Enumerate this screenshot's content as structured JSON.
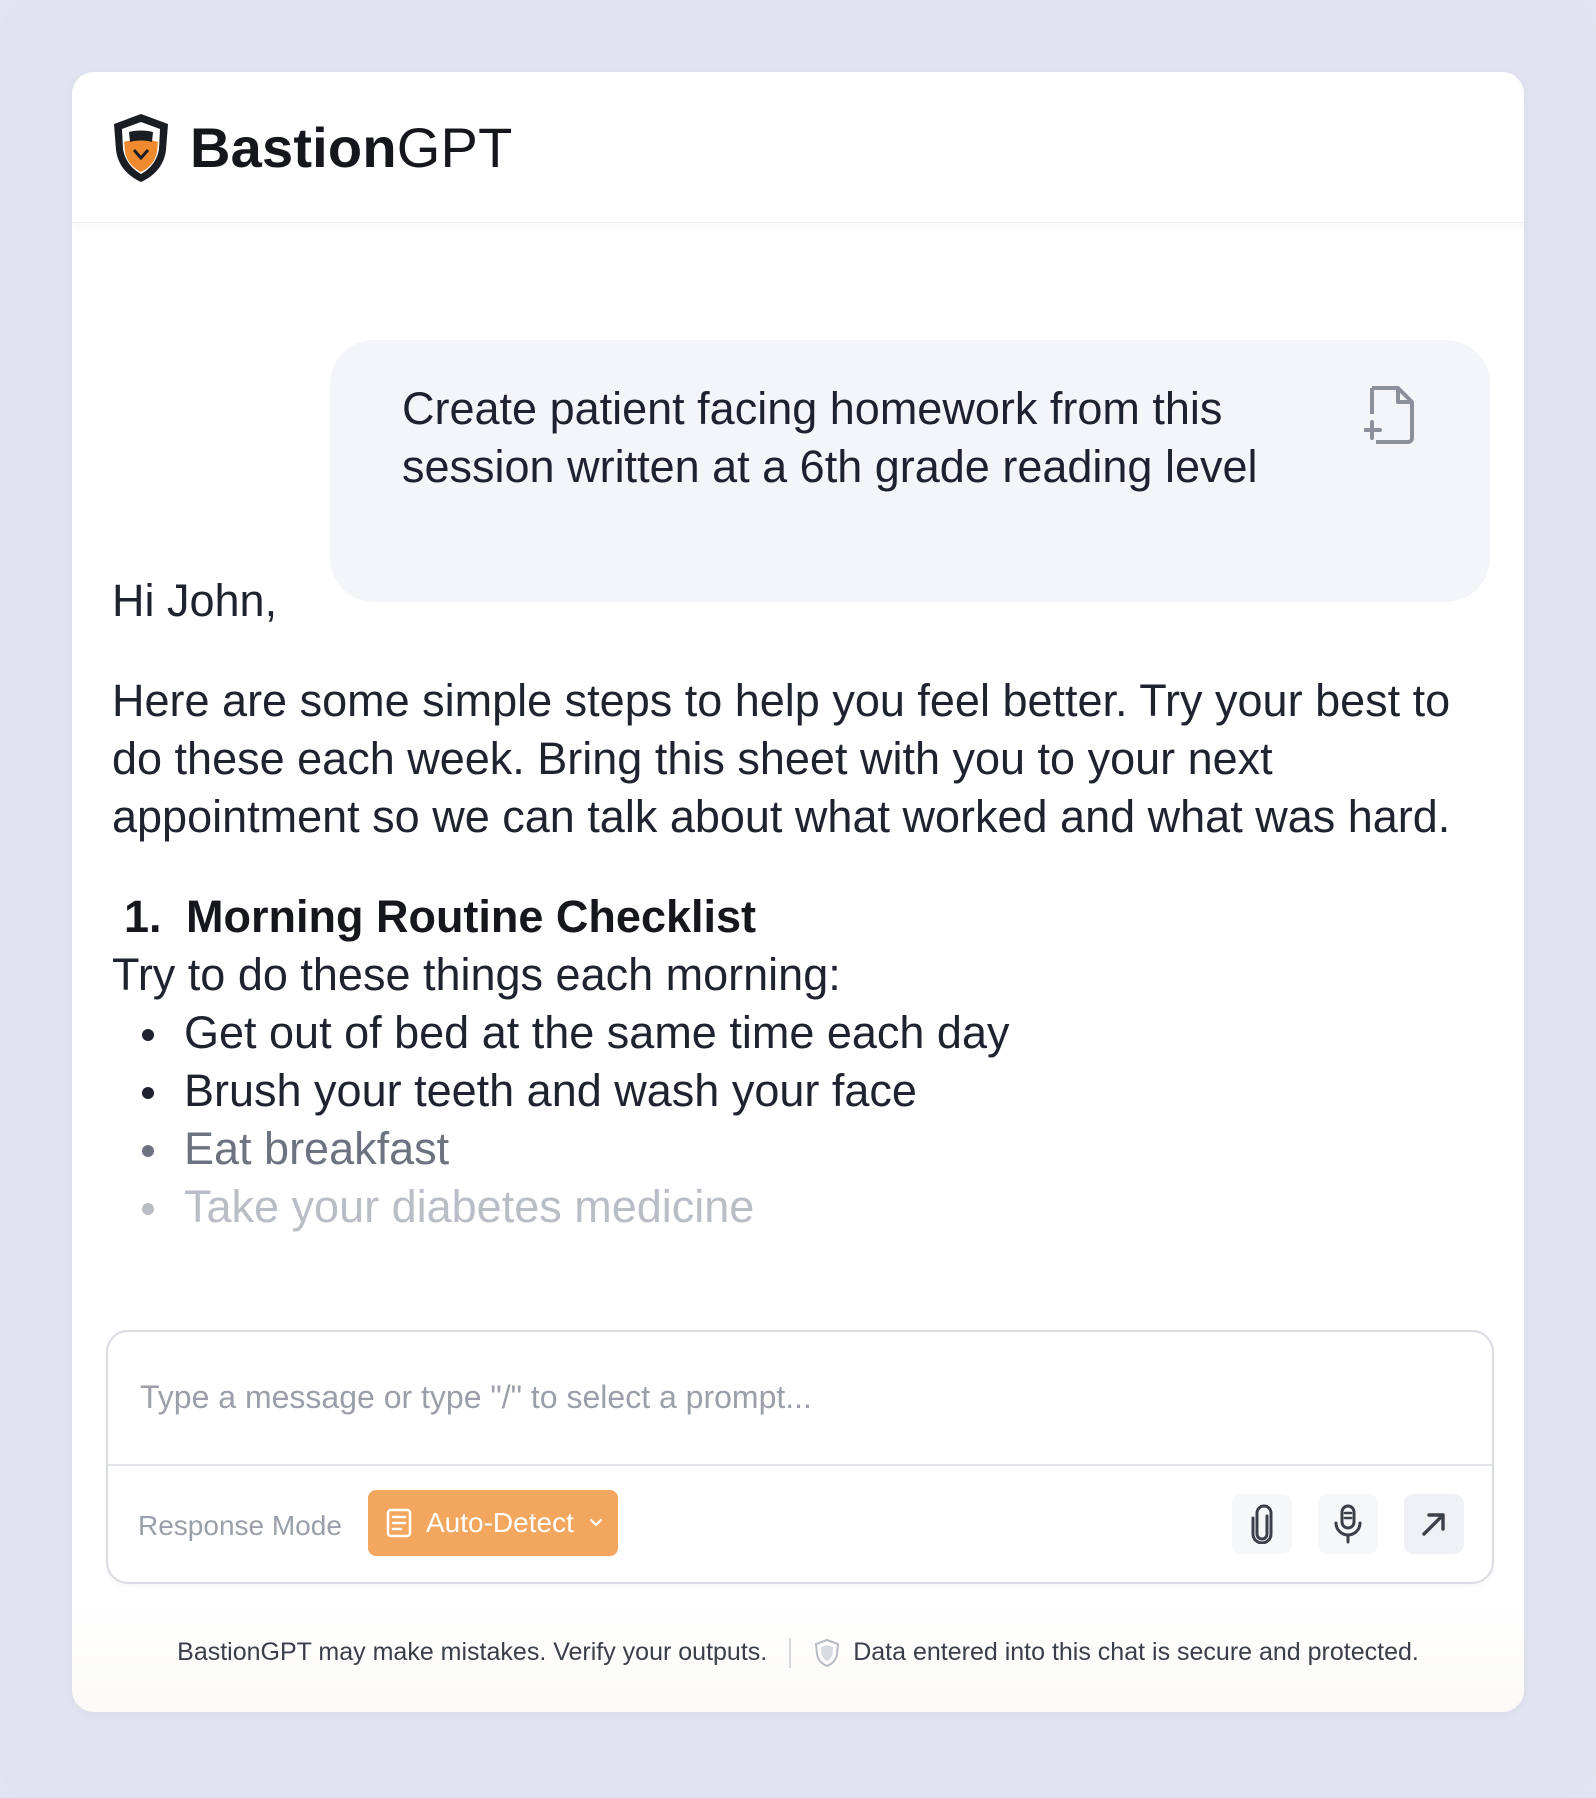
{
  "app": {
    "brand_bold": "Bastion",
    "brand_light": "GPT"
  },
  "conversation": {
    "user_message": "Create patient facing homework from this session written at a 6th grade reading level",
    "assistant": {
      "greeting": "Hi John,",
      "intro": "Here are some simple steps to help you feel better. Try your best to do these each week. Bring this sheet with you to your next appointment so we can talk about what worked and what was hard.",
      "section_number": "1.",
      "section_title": "Morning Routine Checklist",
      "section_lead": "Try to do these things each morning:",
      "bullets": [
        "Get out of bed at the same time each day",
        "Brush your teeth and wash your face",
        "Eat breakfast",
        "Take your diabetes medicine"
      ]
    }
  },
  "composer": {
    "placeholder": "Type a message or type \"/\" to select a prompt...",
    "response_mode_label": "Response Mode",
    "mode_button_label": "Auto-Detect",
    "accent_color": "#f2a65e"
  },
  "footer": {
    "disclaimer": "BastionGPT may make mistakes. Verify your outputs.",
    "security_note": "Data entered into this chat is secure and protected."
  },
  "icons": {
    "logo": "shield-logo-icon",
    "attach_to_prompt": "file-plus-icon",
    "mode": "book-icon",
    "dropdown": "chevron-down-icon",
    "attach": "paperclip-icon",
    "voice": "microphone-icon",
    "send": "arrow-up-right-icon",
    "security": "shield-icon"
  }
}
